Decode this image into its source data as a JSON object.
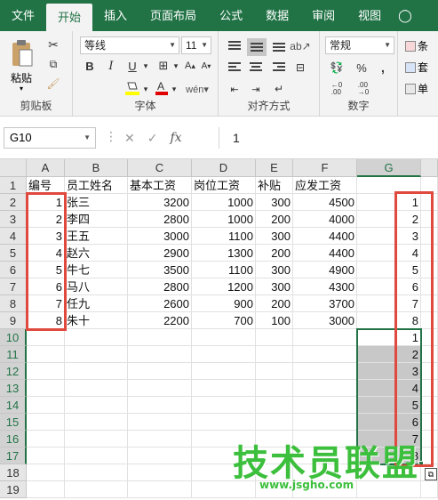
{
  "ribbon_tabs": [
    "文件",
    "开始",
    "插入",
    "页面布局",
    "公式",
    "数据",
    "审阅",
    "视图"
  ],
  "active_tab": "开始",
  "clipboard": {
    "paste_label": "粘贴",
    "group_label": "剪贴板"
  },
  "font": {
    "name": "等线",
    "size": "11",
    "group_label": "字体"
  },
  "alignment": {
    "group_label": "对齐方式"
  },
  "number": {
    "format": "常规",
    "group_label": "数字"
  },
  "styles": {
    "items": [
      "条",
      "套",
      "单"
    ]
  },
  "formula_bar": {
    "name_box": "G10",
    "value": "1"
  },
  "columns": [
    "A",
    "B",
    "C",
    "D",
    "E",
    "F",
    "G"
  ],
  "rows": [
    "1",
    "2",
    "3",
    "4",
    "5",
    "6",
    "7",
    "8",
    "9",
    "10",
    "11",
    "12",
    "13",
    "14",
    "15",
    "16",
    "17",
    "18",
    "19"
  ],
  "headers": [
    "编号",
    "员工姓名",
    "基本工资",
    "岗位工资",
    "补贴",
    "应发工资"
  ],
  "table": [
    [
      "1",
      "张三",
      "3200",
      "1000",
      "300",
      "4500"
    ],
    [
      "2",
      "李四",
      "2800",
      "1000",
      "200",
      "4000"
    ],
    [
      "3",
      "王五",
      "3000",
      "1100",
      "300",
      "4400"
    ],
    [
      "4",
      "赵六",
      "2900",
      "1300",
      "200",
      "4400"
    ],
    [
      "5",
      "牛七",
      "3500",
      "1100",
      "300",
      "4900"
    ],
    [
      "6",
      "马八",
      "2800",
      "1200",
      "300",
      "4300"
    ],
    [
      "7",
      "任九",
      "2600",
      "900",
      "200",
      "3700"
    ],
    [
      "8",
      "朱十",
      "2200",
      "700",
      "100",
      "3000"
    ]
  ],
  "col_g": [
    "1",
    "2",
    "3",
    "4",
    "5",
    "6",
    "7",
    "8",
    "1",
    "2",
    "3",
    "4",
    "5",
    "6",
    "7",
    "8"
  ],
  "watermark": {
    "main": "技术员联盟",
    "sub": "www.jsgho.com"
  }
}
